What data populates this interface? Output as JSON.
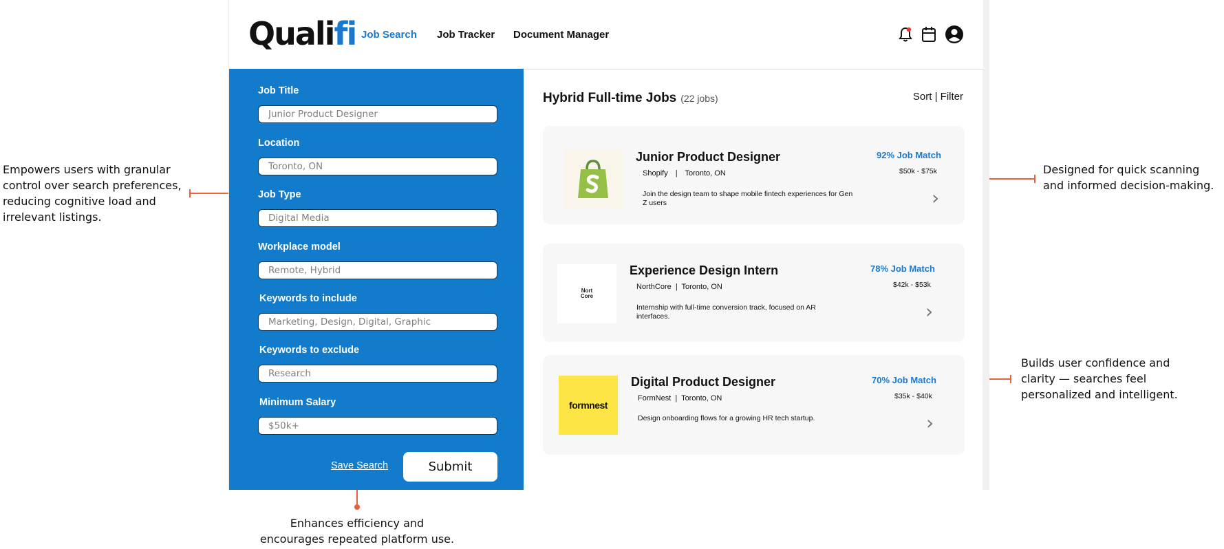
{
  "header": {
    "logo_main": "Quali",
    "logo_accent": "fi",
    "nav": [
      "Job Search",
      "Job Tracker",
      "Document Manager"
    ],
    "active_nav": "Job Search"
  },
  "icons": [
    "notification-bell-icon",
    "calendar-icon",
    "user-account-icon"
  ],
  "form": {
    "fields": [
      {
        "label": "Job Title",
        "value": "Junior Product Designer"
      },
      {
        "label": "Location",
        "value": "Toronto, ON"
      },
      {
        "label": "Job Type",
        "value": "Digital Media"
      },
      {
        "label": "Workplace model",
        "value": "Remote, Hybrid"
      },
      {
        "label": "Keywords to include",
        "value": "Marketing, Design, Digital, Graphic"
      },
      {
        "label": "Keywords to exclude",
        "value": "Research"
      },
      {
        "label": "Minimum Salary",
        "value": "$50k+"
      }
    ],
    "save_label": "Save Search",
    "submit_label": "Submit"
  },
  "results": {
    "title": "Hybrid Full-time Jobs",
    "count": "(22 jobs)",
    "sort_label": "Sort",
    "divider": "|",
    "filter_label": "Filter",
    "jobs": [
      {
        "title": "Junior Product Designer",
        "company": "Shopify",
        "location": "Toronto, ON",
        "description": "Join the design team to shape mobile fintech experiences for Gen Z users",
        "match": "92% Job Match",
        "salary": "$50k - $75k",
        "logo_text": ""
      },
      {
        "title": "Experience Design Intern",
        "company": "NorthCore",
        "location": "Toronto, ON",
        "description": "Internship with full-time conversion track, focused on AR interfaces.",
        "match": "78% Job Match",
        "salary": "$42k - $53k",
        "logo_text": "Nort Core"
      },
      {
        "title": "Digital Product Designer",
        "company": "FormNest",
        "location": "Toronto, ON",
        "description": "Design onboarding flows for a growing HR tech startup.",
        "match": "70% Job Match",
        "salary": "$35k - $40k",
        "logo_text": "formnest"
      }
    ]
  },
  "annotations": {
    "left": "Empowers users with granular control over search preferences, reducing cognitive load and irrelevant listings.",
    "right_top": "Designed for quick scanning and informed decision-making.",
    "right_bottom": "Builds user confidence and clarity — searches feel personalized and intelligent.",
    "bottom": "Enhances efficiency and encourages repeated platform use."
  },
  "colors": {
    "brand_blue": "#137bcb",
    "accent_orange": "#e8623c",
    "shopify_green": "#95bf47",
    "formnest_yellow": "#fde545"
  }
}
